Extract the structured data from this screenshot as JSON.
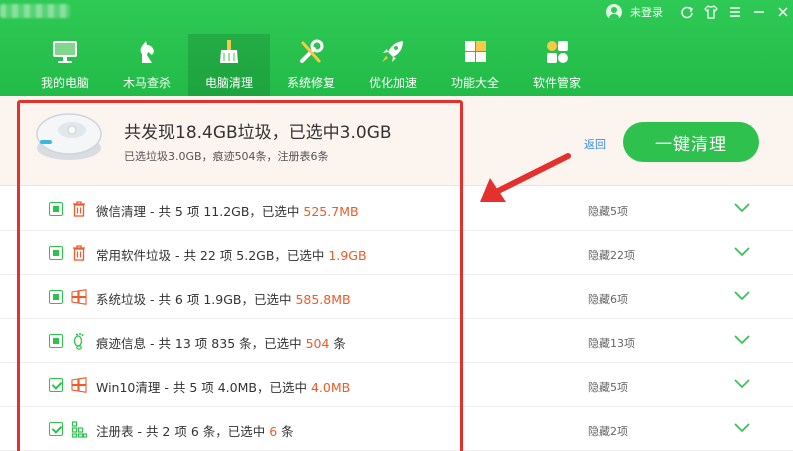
{
  "titlebar": {
    "login_text": "未登录"
  },
  "nav": {
    "items": [
      {
        "label": "我的电脑",
        "icon": "monitor-icon"
      },
      {
        "label": "木马查杀",
        "icon": "horse-icon"
      },
      {
        "label": "电脑清理",
        "icon": "broom-icon"
      },
      {
        "label": "系统修复",
        "icon": "tools-icon"
      },
      {
        "label": "优化加速",
        "icon": "rocket-icon"
      },
      {
        "label": "功能大全",
        "icon": "grid-icon"
      },
      {
        "label": "软件管家",
        "icon": "apps-icon"
      }
    ],
    "active": "电脑清理"
  },
  "summary": {
    "title": "共发现18.4GB垃圾，已选中3.0GB",
    "subtitle": "已选垃圾3.0GB，痕迹504条，注册表6条",
    "back_label": "返回",
    "clean_button": "一键清理"
  },
  "rows": [
    {
      "text": "微信清理 - 共 5 项 11.2GB，已选中 ",
      "selected": "525.7MB",
      "hidden": "隐藏5项",
      "state": "partial",
      "icon": "trash-icon"
    },
    {
      "text": "常用软件垃圾 - 共 22 项 5.2GB，已选中 ",
      "selected": "1.9GB",
      "hidden": "隐藏22项",
      "state": "partial",
      "icon": "trash-icon"
    },
    {
      "text": "系统垃圾 - 共 6 项 1.9GB，已选中 ",
      "selected": "585.8MB",
      "hidden": "隐藏6项",
      "state": "partial",
      "icon": "windows-icon"
    },
    {
      "text": "痕迹信息 - 共 13 项 835 条，已选中 ",
      "selected": "504",
      "suffix": " 条",
      "hidden": "隐藏13项",
      "state": "partial",
      "icon": "footprint-icon"
    },
    {
      "text": "Win10清理 - 共 5 项 4.0MB，已选中 ",
      "selected": "4.0MB",
      "hidden": "隐藏5项",
      "state": "checked",
      "icon": "windows-icon"
    },
    {
      "text": "注册表 - 共 2 项 6 条，已选中 ",
      "selected": "6",
      "suffix": " 条",
      "hidden": "隐藏2项",
      "state": "checked",
      "icon": "registry-icon"
    }
  ],
  "colors": {
    "brand_green": "#2fc14d",
    "selected_orange": "#f05a28",
    "annotation_red": "#e5312d"
  }
}
